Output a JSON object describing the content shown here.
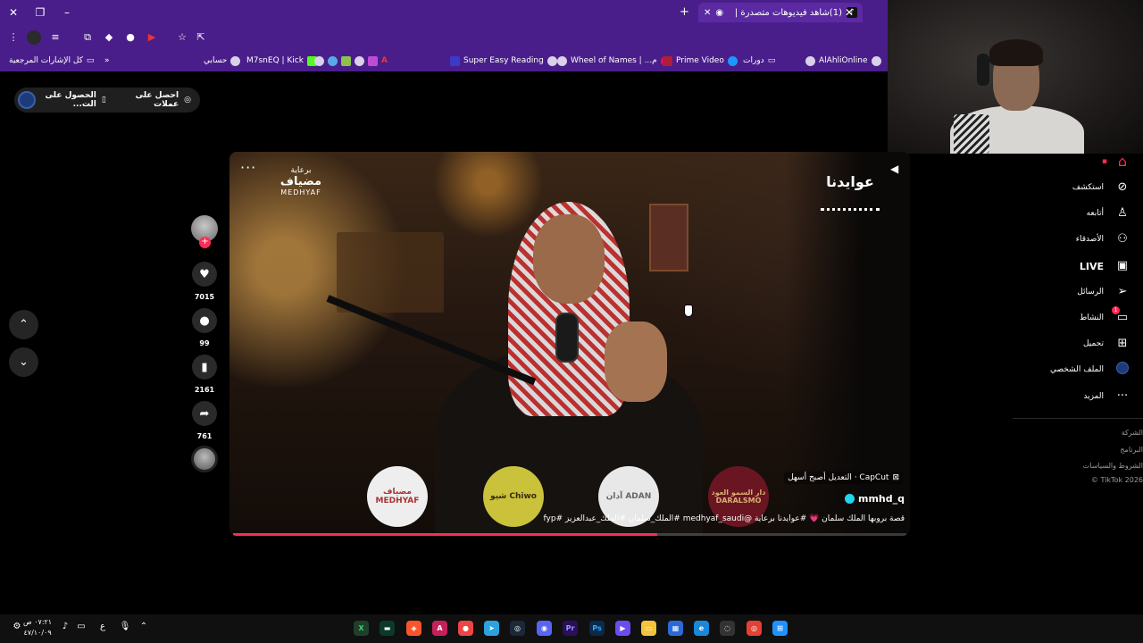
{
  "browser": {
    "tab_title": "(1)شاهد فيديوهات متصدرة |",
    "tab_icon": "tiktok-icon",
    "bookmarks": [
      {
        "label": "كل الإشارات المرجعية",
        "icon": "folder-icon"
      },
      {
        "label": "حسابي",
        "icon": "globe-icon"
      },
      {
        "label": "M7snEQ | Kick",
        "icon": "kick-icon"
      },
      {
        "label": "Super Easy Reading",
        "icon": "globe-icon"
      },
      {
        "label": "Wheel of Names | ...م",
        "icon": "globe-icon"
      },
      {
        "label": "Prime Video",
        "icon": "prime-icon"
      },
      {
        "label": "دورات",
        "icon": "folder-icon"
      },
      {
        "label": "AlAhliOnline",
        "icon": "globe-icon"
      }
    ]
  },
  "promo": {
    "get_coins": "احصل على عملات",
    "get_app": "الحصول على الت..."
  },
  "video": {
    "sponsor_top": "برعاية",
    "sponsor_ar": "مضياف",
    "sponsor_en": "MEDHYAF",
    "show_logo": "عوايدنا",
    "capcut": "CapCut · التعديل أصبح أسهل",
    "username": "mmhd_q",
    "caption": "قصة بروبها الملك سلمان 💗 #عوايدنا برعاية @medhyaf_saudi #الملك_سلمان #الملك_عبدالعزيز #fyp",
    "progress": 0.63,
    "circle_logos": [
      "مضياف MEDHYAF",
      "شيو Chiwo",
      "آدان ADAN",
      "دار السمو العود DARALSMO"
    ]
  },
  "actions": {
    "likes": "7015",
    "comments": "99",
    "saves": "2161",
    "shares": "761"
  },
  "sidebar": {
    "items": [
      {
        "label": "استكشف",
        "icon": "compass-icon"
      },
      {
        "label": "أتابعه",
        "icon": "user-plus-icon"
      },
      {
        "label": "الأصدقاء",
        "icon": "friends-icon"
      },
      {
        "label": "LIVE",
        "icon": "live-icon"
      },
      {
        "label": "الرسائل",
        "icon": "send-icon"
      },
      {
        "label": "النشاط",
        "icon": "activity-icon",
        "badge": "1"
      },
      {
        "label": "تحميل",
        "icon": "upload-icon"
      },
      {
        "label": "الملف الشخصي",
        "icon": "profile-icon"
      },
      {
        "label": "المزيد",
        "icon": "more-icon"
      }
    ],
    "footer": [
      "الشركة",
      "البرنامج",
      "الشروط والسياسات",
      "TikTok 2026 ©"
    ]
  },
  "taskbar": {
    "time": "٠٧:٢١ ص",
    "date": "٤٧/١٠/٠٩",
    "lang": "ع"
  },
  "colors": {
    "browser_purple": "#4a1e8a",
    "tiktok_pink": "#fe2c55",
    "verified_cyan": "#20d5ec"
  }
}
